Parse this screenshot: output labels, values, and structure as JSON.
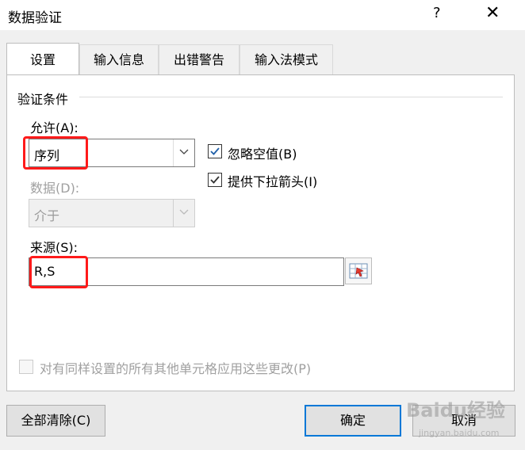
{
  "window": {
    "title": "数据验证",
    "help": "?",
    "close": "✕"
  },
  "tabs": [
    {
      "label": "设置",
      "active": true
    },
    {
      "label": "输入信息"
    },
    {
      "label": "出错警告"
    },
    {
      "label": "输入法模式"
    }
  ],
  "criteria": {
    "group_label": "验证条件",
    "allow_label": "允许(A):",
    "allow_value": "序列",
    "data_label": "数据(D):",
    "data_value": "介于",
    "source_label": "来源(S):",
    "source_value": "R,S",
    "ignore_blank": {
      "label": "忽略空值(B)",
      "checked": true
    },
    "in_cell_dropdown": {
      "label": "提供下拉箭头(I)",
      "checked": true
    },
    "apply_all": {
      "label": "对有同样设置的所有其他单元格应用这些更改(P)",
      "checked": false
    }
  },
  "buttons": {
    "clear_all": "全部清除(C)",
    "ok": "确定",
    "cancel": "取消"
  },
  "watermark": {
    "brand": "Baidu经验",
    "url": "jingyan.baidu.com"
  },
  "colors": {
    "highlight": "#ff1a1a",
    "accent": "#0078d7",
    "check": "#1f5fa8"
  }
}
